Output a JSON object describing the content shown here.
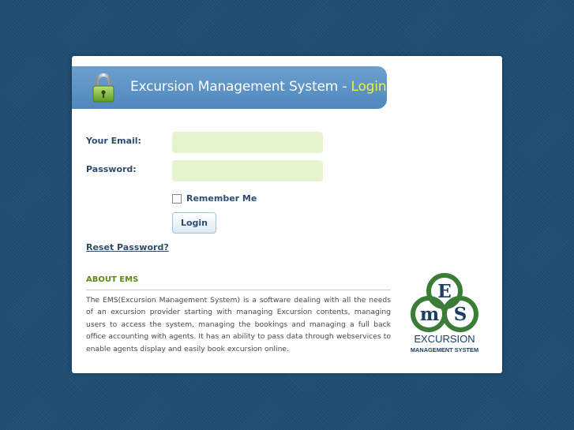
{
  "header": {
    "title": "Excursion Management System - ",
    "title_accent": "Login",
    "icon": "lock-icon"
  },
  "form": {
    "email_label": "Your Email:",
    "email_value": "",
    "password_label": "Password:",
    "password_value": "",
    "remember_label": "Remember Me",
    "remember_checked": false,
    "login_button": "Login",
    "reset_link": "Reset Password?"
  },
  "about": {
    "heading": "ABOUT EMS",
    "text": "The EMS(Excursion Management System) is a software dealing with all the needs of an excursion provider starting with managing Excursion contents, managing users to access the system, managing the bookings and managing a full back office accounting with agents. It has an ability to pass data through webservices to enable agents display and easily book excursion online."
  },
  "logo": {
    "letter_e": "E",
    "letter_m": "m",
    "letter_s": "S",
    "name": "EXCURSION",
    "subtitle": "MANAGEMENT SYSTEM"
  },
  "colors": {
    "background": "#1f4f74",
    "title_bar": "#5b93c6",
    "title_accent": "#f0f03c",
    "input_fill": "#e6f3cf",
    "label_text": "#2d4d6f",
    "about_heading": "#5e8a14",
    "logo_green": "#3b7d36",
    "logo_navy": "#1d3e63"
  }
}
